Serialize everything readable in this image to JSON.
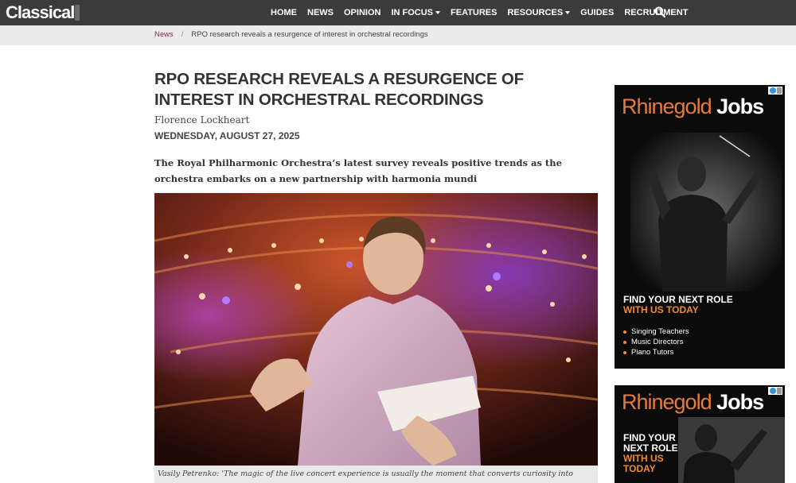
{
  "header": {
    "logo": "Classical",
    "nav": [
      {
        "label": "HOME",
        "dropdown": false
      },
      {
        "label": "NEWS",
        "dropdown": false
      },
      {
        "label": "OPINION",
        "dropdown": false
      },
      {
        "label": "IN FOCUS",
        "dropdown": true
      },
      {
        "label": "FEATURES",
        "dropdown": false
      },
      {
        "label": "RESOURCES",
        "dropdown": true
      },
      {
        "label": "GUIDES",
        "dropdown": false
      },
      {
        "label": "RECRUITMENT",
        "dropdown": false
      }
    ],
    "search_icon": "search-icon"
  },
  "breadcrumb": {
    "parent": "News",
    "separator": "/",
    "current": "RPO research reveals a resurgence of interest in orchestral recordings"
  },
  "article": {
    "title": "RPO RESEARCH REVEALS A RESURGENCE OF INTEREST IN ORCHESTRAL RECORDINGS",
    "author": "Florence Lockheart",
    "date": "WEDNESDAY, AUGUST 27, 2025",
    "standfirst": "The Royal Philharmonic Orchestra’s latest survey reveals positive trends as the orchestra embarks on a new partnership with harmonia mundi",
    "caption": "Vasily Petrenko: 'The magic of the live concert experience is usually the moment that converts curiosity into"
  },
  "ads": [
    {
      "brand_part1": "Rhinegold",
      "brand_part2": "Jobs",
      "cta_line1": "FIND YOUR NEXT ROLE",
      "cta_line2": "WITH US TODAY",
      "list": [
        "Singing Teachers",
        "Music Directors",
        "Piano Tutors"
      ]
    },
    {
      "brand_part1": "Rhinegold",
      "brand_part2": "Jobs",
      "cta_line1": "FIND YOUR",
      "cta_line2": "NEXT ROLE",
      "cta_line3": "WITH US",
      "cta_line4": "TODAY"
    }
  ],
  "colors": {
    "topbar": "#3b3b3b",
    "breadcrumb_link": "#8a2a4a",
    "ad_accent": "#f08a34"
  }
}
